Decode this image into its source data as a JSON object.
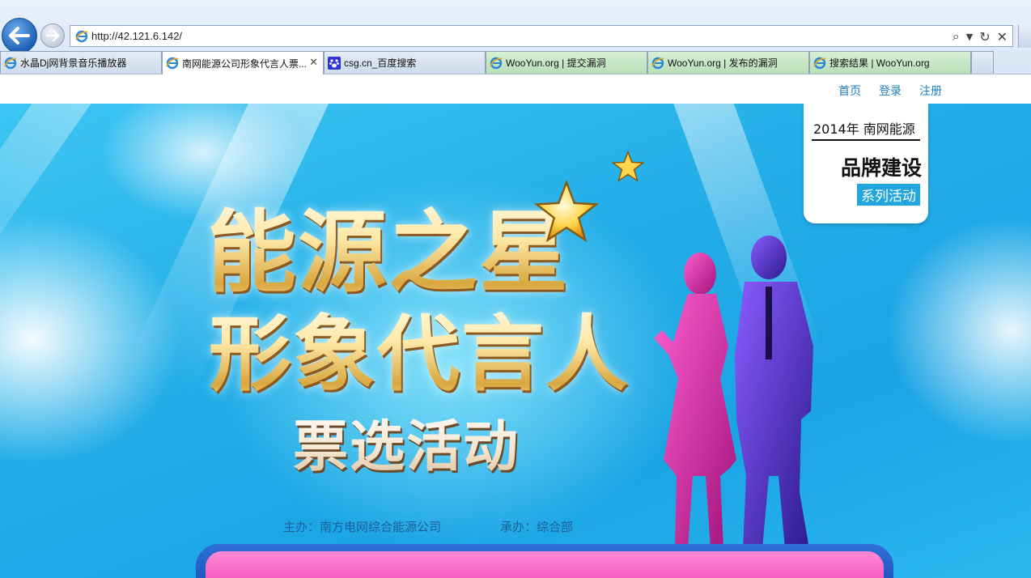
{
  "browser": {
    "url": "http://42.121.6.142/",
    "tabs": [
      {
        "label": "水晶Dj网背景音乐播放器",
        "icon": "ie-icon"
      },
      {
        "label": "南网能源公司形象代言人票...",
        "icon": "ie-icon",
        "active": true
      },
      {
        "label": "csg.cn_百度搜索",
        "icon": "baidu-paw-icon"
      },
      {
        "label": "WooYun.org | 提交漏洞",
        "icon": "ie-icon"
      },
      {
        "label": "WooYun.org | 发布的漏洞",
        "icon": "ie-icon"
      },
      {
        "label": "搜索结果 | WooYun.org",
        "icon": "ie-icon"
      }
    ]
  },
  "header": {
    "links": [
      "首页",
      "登录",
      "注册"
    ]
  },
  "badge": {
    "year_line": "2014年 南网能源",
    "main": "品牌建设",
    "sub": "系列活动"
  },
  "hero": {
    "title_line1": "能源之星",
    "title_line2": "形象代言人",
    "title_line3": "票选活动",
    "sponsor": "主办：南方电网综合能源公司",
    "organizer": "承办：综合部"
  },
  "colors": {
    "link": "#1a7fc4",
    "badge_accent": "#22a6df",
    "hero_blue": "#24aee8",
    "bar_pink": "#f03cb4"
  }
}
